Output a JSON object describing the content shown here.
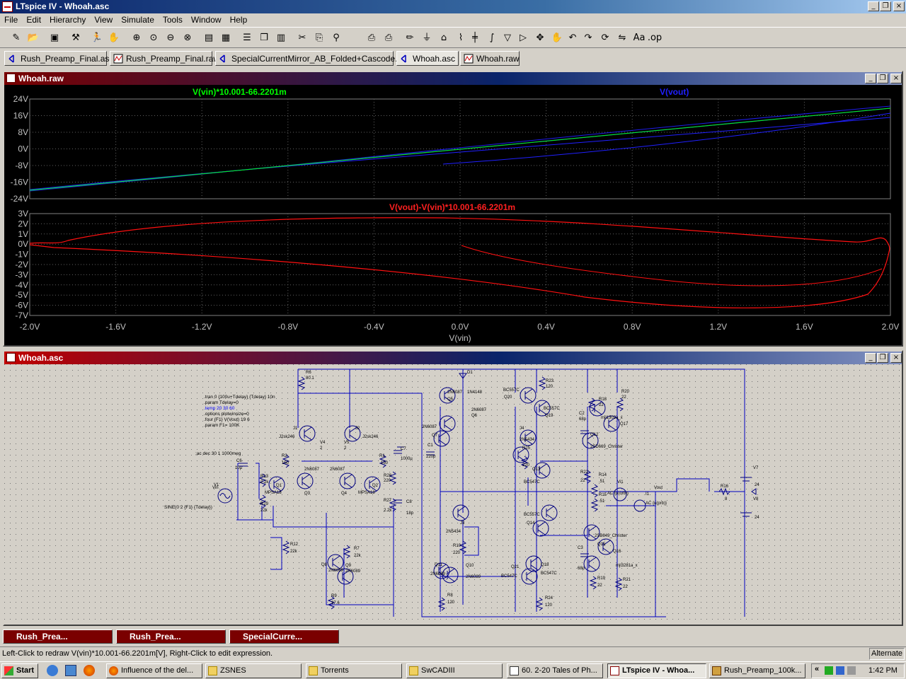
{
  "app": {
    "title": "LTspice IV - Whoah.asc",
    "window_buttons": [
      "_",
      "❐",
      "×"
    ]
  },
  "menu": [
    "File",
    "Edit",
    "Hierarchy",
    "View",
    "Simulate",
    "Tools",
    "Window",
    "Help"
  ],
  "tabs": [
    {
      "label": "Rush_Preamp_Final.asc",
      "kind": "schematic",
      "active": false
    },
    {
      "label": "Rush_Preamp_Final.raw",
      "kind": "waveform",
      "active": false
    },
    {
      "label": "SpecialCurrentMirror_AB_Folded+Cascode.asc",
      "kind": "schematic",
      "active": false
    },
    {
      "label": "Whoah.asc",
      "kind": "schematic",
      "active": true
    },
    {
      "label": "Whoah.raw",
      "kind": "waveform",
      "active": false
    }
  ],
  "waveform_window": {
    "title": "Whoah.raw",
    "top_pane": {
      "traces": [
        {
          "label": "V(vin)*10.001-66.2201m",
          "color": "#00ff00"
        },
        {
          "label": "V(vout)",
          "color": "#2020ff"
        }
      ],
      "y_ticks": [
        "24V",
        "16V",
        "8V",
        "0V",
        "-8V",
        "-16V",
        "-24V"
      ]
    },
    "bottom_pane": {
      "traces": [
        {
          "label": "V(vout)-V(vin)*10.001-66.2201m",
          "color": "#ff0000"
        }
      ],
      "y_ticks": [
        "3V",
        "2V",
        "1V",
        "0V",
        "-1V",
        "-2V",
        "-3V",
        "-4V",
        "-5V",
        "-6V",
        "-7V"
      ]
    },
    "x_ticks": [
      "-2.0V",
      "-1.6V",
      "-1.2V",
      "-0.8V",
      "-0.4V",
      "0.0V",
      "0.4V",
      "0.8V",
      "1.2V",
      "1.6V",
      "2.0V"
    ],
    "x_label": "V(vin)"
  },
  "schematic_window": {
    "title": "Whoah.asc",
    "directives": [
      ".tran 0 {100u+Tdelay} {Tdelay} 10n",
      ".param Tdelay=0",
      ".temp 20 30 60",
      ".options plotwinsize=0",
      ".four {F1} V(Vout) 19 6",
      ".param F1= 100K"
    ],
    "ac_directive": ";ac dec 30 1 1000meg",
    "source_label": "SINE(0 2 {F1} {Tdelay})",
    "labels": [
      {
        "t": "R6"
      },
      {
        "t": "80.1"
      },
      {
        "t": "D1"
      },
      {
        "t": "1N4148"
      },
      {
        "t": "Q5"
      },
      {
        "t": "2N6087"
      },
      {
        "t": "2N6087"
      },
      {
        "t": "Q6"
      },
      {
        "t": "BC557C"
      },
      {
        "t": "Q20"
      },
      {
        "t": "R23"
      },
      {
        "t": "120"
      },
      {
        "t": "BC557C"
      },
      {
        "t": "Q19"
      },
      {
        "t": "R18"
      },
      {
        "t": "22"
      },
      {
        "t": "R20"
      },
      {
        "t": "22"
      },
      {
        "t": "mjl1302a_x"
      },
      {
        "t": "Q17"
      },
      {
        "t": "C2"
      },
      {
        "t": "68p"
      },
      {
        "t": "Q12"
      },
      {
        "t": "2SD669_Christer"
      },
      {
        "t": "J1"
      },
      {
        "t": "J2"
      },
      {
        "t": "J2sk246"
      },
      {
        "t": "J2sk246"
      },
      {
        "t": "V4"
      },
      {
        "t": "V5"
      },
      {
        "t": "2"
      },
      {
        "t": "2"
      },
      {
        "t": "2N6087"
      },
      {
        "t": "2N6087"
      },
      {
        "t": "2N6087"
      },
      {
        "t": "Q7"
      },
      {
        "t": "C1"
      },
      {
        "t": "220p"
      },
      {
        "t": "J4"
      },
      {
        "t": "2N5434"
      },
      {
        "t": "R25"
      },
      {
        "t": "220"
      },
      {
        "t": "Q13"
      },
      {
        "t": "BC547C"
      },
      {
        "t": "C6"
      },
      {
        "t": "10µ"
      },
      {
        "t": "R2"
      },
      {
        "t": "150"
      },
      {
        "t": "R1"
      },
      {
        "t": "150"
      },
      {
        "t": "C7"
      },
      {
        "t": "1000µ"
      },
      {
        "t": "R13"
      },
      {
        "t": "2.2k"
      },
      {
        "t": "Q1"
      },
      {
        "t": "Q3"
      },
      {
        "t": "Q4"
      },
      {
        "t": "Q2"
      },
      {
        "t": "R28"
      },
      {
        "t": "220"
      },
      {
        "t": "V1"
      },
      {
        "t": "MPSA18"
      },
      {
        "t": "MPSA18"
      },
      {
        "t": "R29"
      },
      {
        "t": "22k"
      },
      {
        "t": "R27"
      },
      {
        "t": "2.2k"
      },
      {
        "t": "C8"
      },
      {
        "t": "18p"
      },
      {
        "t": "R22"
      },
      {
        "t": "22"
      },
      {
        "t": "R14"
      },
      {
        "t": ".51"
      },
      {
        "t": "R15"
      },
      {
        "t": ".51"
      },
      {
        "t": "Vi1"
      },
      {
        "t": "AC {u(orb)}"
      },
      {
        "t": "I1"
      },
      {
        "t": "AC {u(prb)}"
      },
      {
        "t": "Vout"
      },
      {
        "t": "R16"
      },
      {
        "t": "8"
      },
      {
        "t": "V7"
      },
      {
        "t": "24"
      },
      {
        "t": "V8"
      },
      {
        "t": "24"
      },
      {
        "t": "J3"
      },
      {
        "t": "2N5434"
      },
      {
        "t": "BC557C"
      },
      {
        "t": "Q14"
      },
      {
        "t": "2SB649_Christer"
      },
      {
        "t": "Q15"
      },
      {
        "t": "Q16"
      },
      {
        "t": "C3"
      },
      {
        "t": "68p"
      },
      {
        "t": "mjl3281a_x"
      },
      {
        "t": "R12"
      },
      {
        "t": "22k"
      },
      {
        "t": "R7"
      },
      {
        "t": "22k"
      },
      {
        "t": "R10"
      },
      {
        "t": "220"
      },
      {
        "t": "Q8"
      },
      {
        "t": "Q9"
      },
      {
        "t": "2N6089"
      },
      {
        "t": "2N6089"
      },
      {
        "t": "Q11"
      },
      {
        "t": "Q10"
      },
      {
        "t": "2N6089"
      },
      {
        "t": "2N6089"
      },
      {
        "t": "Q18"
      },
      {
        "t": "Q21"
      },
      {
        "t": "BC547C"
      },
      {
        "t": "BC547C"
      },
      {
        "t": "R19"
      },
      {
        "t": "22"
      },
      {
        "t": "R21"
      },
      {
        "t": "22"
      },
      {
        "t": "R9"
      },
      {
        "t": "37.6"
      },
      {
        "t": "R8"
      },
      {
        "t": "120"
      },
      {
        "t": "R24"
      },
      {
        "t": "120"
      },
      {
        "t": "Vin"
      }
    ]
  },
  "minimized_windows": [
    {
      "label": "Rush_Prea...",
      "color": "#7a0000"
    },
    {
      "label": "Rush_Prea...",
      "color": "#7a0000"
    },
    {
      "label": "SpecialCurre...",
      "color": "#7a0000"
    }
  ],
  "status": {
    "message": "Left-Click to redraw V(vin)*10.001-66.2201m[V],  Right-Click to edit expression.",
    "mode": "Alternate"
  },
  "taskbar": {
    "start": "Start",
    "tasks": [
      {
        "label": "Influence of the del...",
        "active": false
      },
      {
        "label": "ZSNES",
        "active": false
      },
      {
        "label": "Torrents",
        "active": false
      },
      {
        "label": "SwCADIII",
        "active": false
      },
      {
        "label": "60. 2-20 Tales of Ph...",
        "active": false
      },
      {
        "label": "LTspice IV - Whoa...",
        "active": true
      },
      {
        "label": "Rush_Preamp_100k...",
        "active": false
      }
    ],
    "clock": "1:42 PM"
  }
}
